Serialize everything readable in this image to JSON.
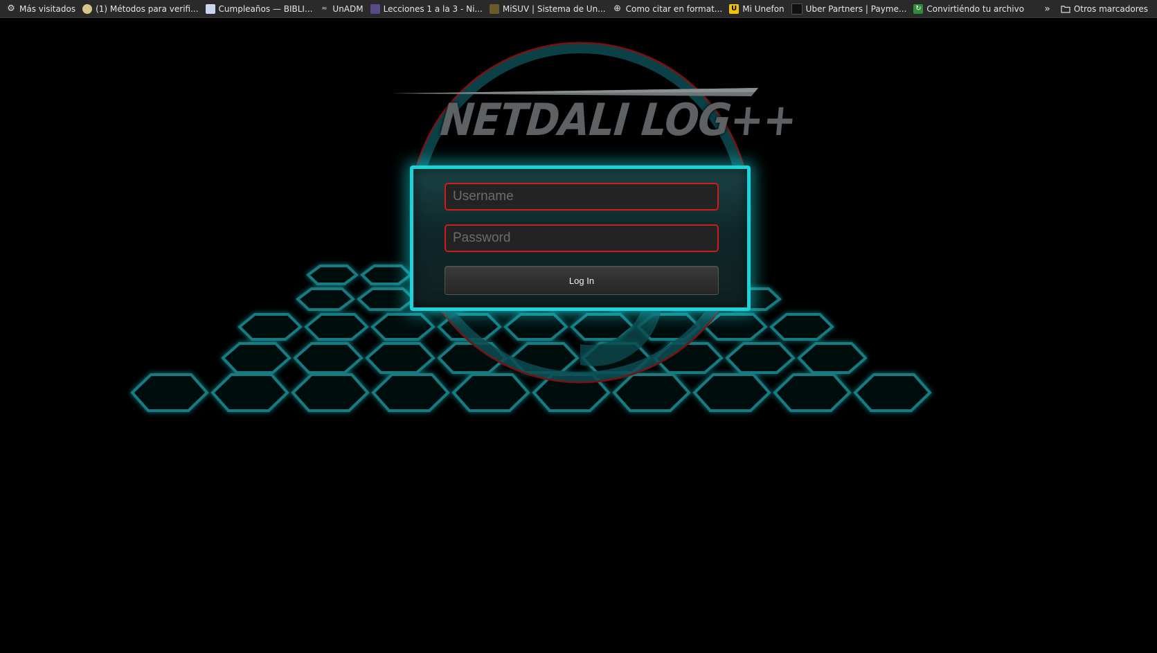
{
  "bookmarks": {
    "items": [
      {
        "label": "Más visitados",
        "icon": "gear-icon"
      },
      {
        "label": "(1) Métodos para verifi...",
        "icon": "page-icon"
      },
      {
        "label": "Cumpleaños — BIBLI...",
        "icon": "page-icon"
      },
      {
        "label": "UnADM",
        "icon": "page-icon"
      },
      {
        "label": "Lecciones 1 a la 3 - Ni...",
        "icon": "page-icon"
      },
      {
        "label": "MiSUV | Sistema de Un...",
        "icon": "page-icon"
      },
      {
        "label": "Como citar en format...",
        "icon": "globe-icon"
      },
      {
        "label": "Mi Unefon",
        "icon": "unefon-icon"
      },
      {
        "label": "Uber Partners | Payme...",
        "icon": "uber-icon"
      },
      {
        "label": "Convirtiéndo tu archivo",
        "icon": "convert-icon"
      }
    ],
    "overflow_label": "»",
    "other_label": "Otros marcadores"
  },
  "logo": {
    "text": "NETDALI LOG++"
  },
  "login": {
    "username_placeholder": "Username",
    "password_placeholder": "Password",
    "button_label": "Log In"
  },
  "colors": {
    "accent": "#1bd3d8",
    "error_border": "#d41a1a",
    "logo_text": "#5d6163"
  }
}
